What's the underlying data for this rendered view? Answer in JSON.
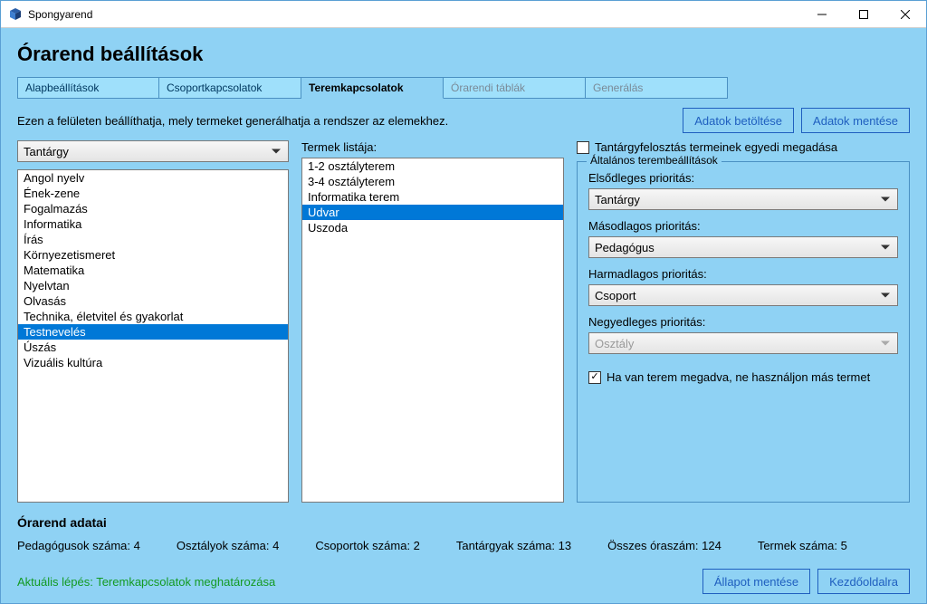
{
  "app": {
    "title": "Spongyarend"
  },
  "page": {
    "heading": "Órarend beállítások"
  },
  "tabs": [
    {
      "label": "Alapbeállítások",
      "state": "normal"
    },
    {
      "label": "Csoportkapcsolatok",
      "state": "normal"
    },
    {
      "label": "Teremkapcsolatok",
      "state": "active"
    },
    {
      "label": "Órarendi táblák",
      "state": "disabled"
    },
    {
      "label": "Generálás",
      "state": "disabled"
    }
  ],
  "instruction": "Ezen a felületen beállíthatja, mely termeket generálhatja a rendszer az elemekhez.",
  "buttons": {
    "load": "Adatok betöltése",
    "save": "Adatok mentése",
    "save_state": "Állapot mentése",
    "home": "Kezdőoldalra"
  },
  "left": {
    "filter_selected": "Tantárgy",
    "items": [
      "Angol nyelv",
      "Ének-zene",
      "Fogalmazás",
      "Informatika",
      "Írás",
      "Környezetismeret",
      "Matematika",
      "Nyelvtan",
      "Olvasás",
      "Technika, életvitel és gyakorlat",
      "Testnevelés",
      "Úszás",
      "Vizuális kultúra"
    ],
    "selected_index": 10
  },
  "rooms": {
    "label": "Termek listája:",
    "items": [
      "1-2 osztályterem",
      "3-4 osztályterem",
      "Informatika terem",
      "Udvar",
      "Uszoda"
    ],
    "selected_index": 3
  },
  "right": {
    "unique_checkbox_label": "Tantárgyfelosztás termeinek egyedi megadása",
    "unique_checked": false,
    "group_legend": "Általános terembeállítások",
    "priority1_label": "Elsődleges prioritás:",
    "priority1_value": "Tantárgy",
    "priority2_label": "Másodlagos prioritás:",
    "priority2_value": "Pedagógus",
    "priority3_label": "Harmadlagos prioritás:",
    "priority3_value": "Csoport",
    "priority4_label": "Negyedleges prioritás:",
    "priority4_value": "Osztály",
    "priority4_disabled": true,
    "lock_checkbox_label": "Ha van terem megadva, ne használjon más termet",
    "lock_checked": true
  },
  "stats": {
    "title": "Órarend adatai",
    "pedagogusok": "Pedagógusok száma: 4",
    "osztalyok": "Osztályok száma: 4",
    "csoportok": "Csoportok száma: 2",
    "tantargyak": "Tantárgyak száma: 13",
    "orak": "Összes óraszám: 124",
    "termek": "Termek száma: 5"
  },
  "current_step": "Aktuális lépés: Teremkapcsolatok meghatározása"
}
